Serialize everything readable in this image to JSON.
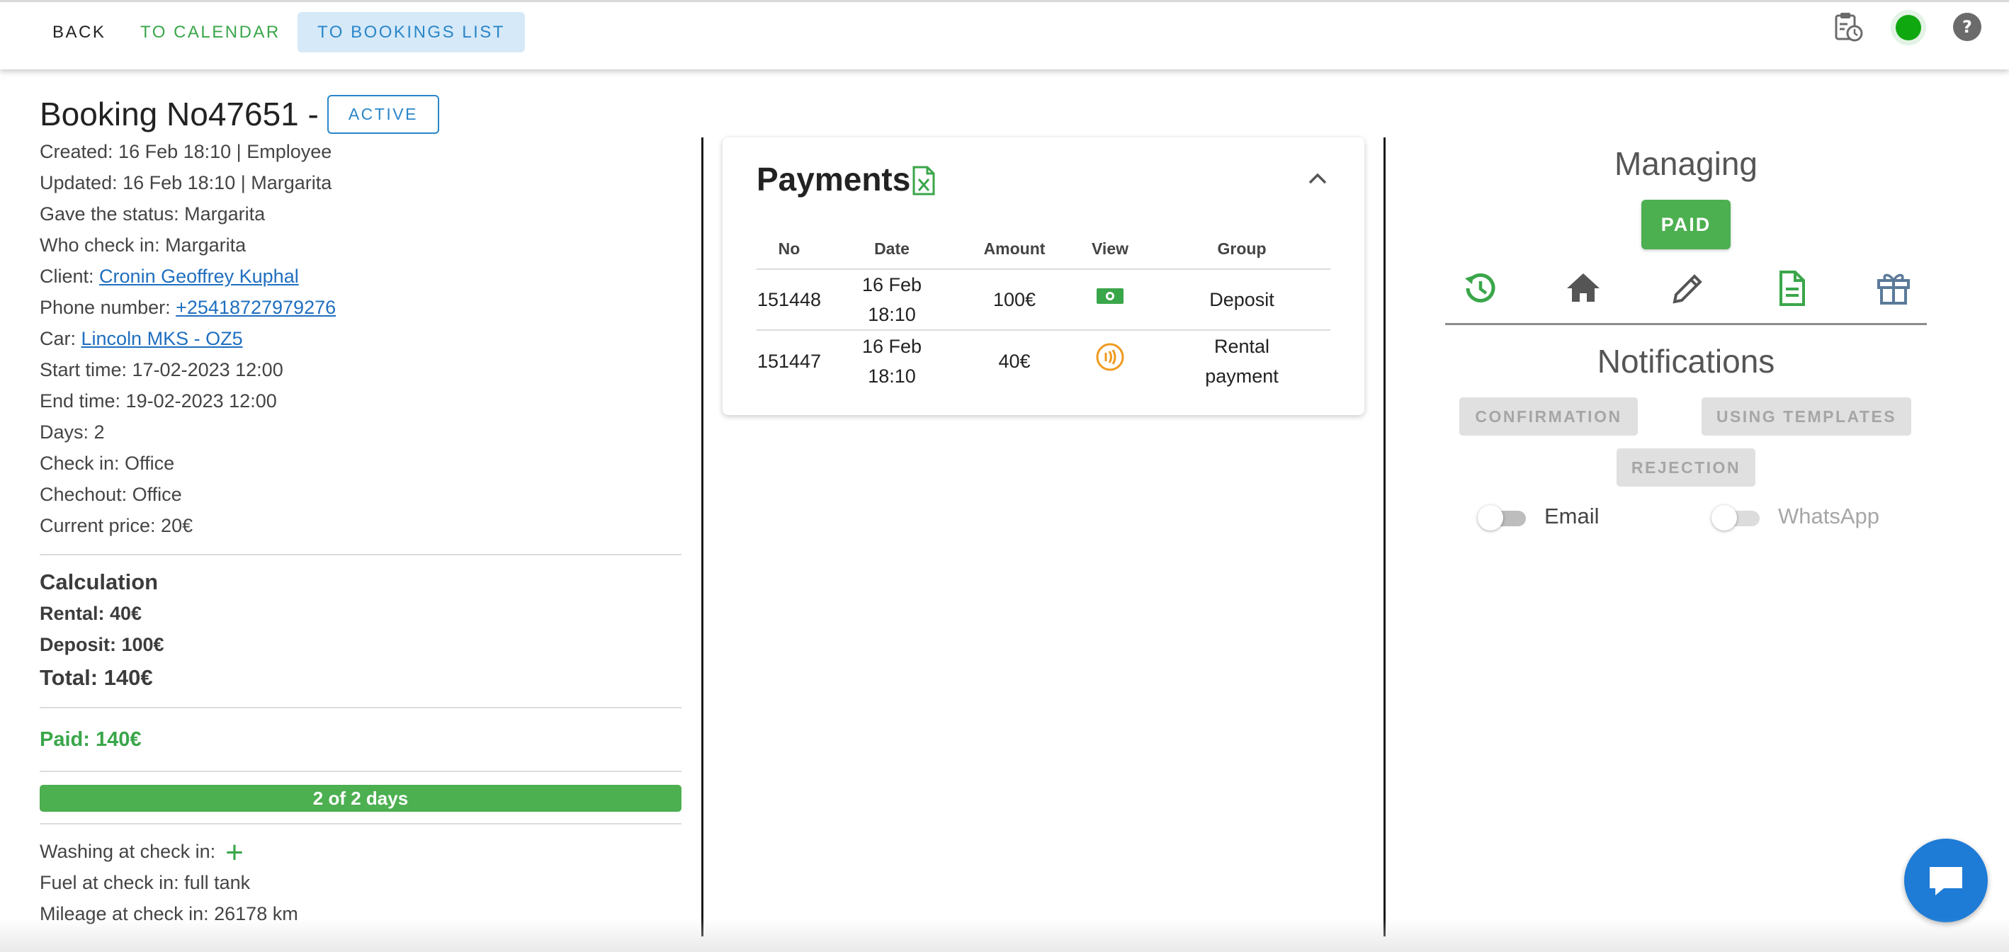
{
  "nav": {
    "back": "BACK",
    "calendar": "TO CALENDAR",
    "bookings_list": "TO BOOKINGS LIST"
  },
  "top_icons": [
    "clipboard-clock-icon",
    "online-status-dot",
    "help-icon"
  ],
  "colors": {
    "green": "#4caf50",
    "blue": "#2a86c9",
    "link": "#1f6fbf",
    "orange": "#f09a1e"
  },
  "booking": {
    "title": "Booking No47651 -",
    "status": "ACTIVE",
    "created": "Created: 16 Feb 18:10 | Employee",
    "updated": "Updated: 16 Feb 18:10 | Margarita",
    "gave_status": "Gave the status: Margarita",
    "who_check_in": "Who check in: Margarita",
    "client_label": "Client: ",
    "client_name": "Cronin Geoffrey Kuphal",
    "phone_label": "Phone number: ",
    "phone": "+25418727979276",
    "car_label": "Car: ",
    "car": "Lincoln MKS - OZ5",
    "start": "Start time: 17-02-2023 12:00",
    "end": "End time: 19-02-2023 12:00",
    "days": "Days: 2",
    "check_in": "Check in: Office",
    "checkout": "Chechout: Office",
    "current_price": "Current price: 20€"
  },
  "calculation": {
    "title": "Calculation",
    "rental": "Rental: 40€",
    "deposit": "Deposit: 100€",
    "total": "Total: 140€",
    "paid": "Paid: 140€",
    "progress_text": "2 of 2 days",
    "progress_fraction": 1.0
  },
  "extra": {
    "washing": "Washing at check in:",
    "fuel": "Fuel at check in: full tank",
    "mileage": "Mileage at check in: 26178 km"
  },
  "payments": {
    "title": "Payments",
    "headers": [
      "No",
      "Date",
      "Amount",
      "View",
      "Group"
    ],
    "rows": [
      {
        "no": "151448",
        "date_line1": "16 Feb",
        "date_line2": "18:10",
        "amount": "100€",
        "view_icon": "cash-icon",
        "group_line1": "Deposit",
        "group_line2": ""
      },
      {
        "no": "151447",
        "date_line1": "16 Feb",
        "date_line2": "18:10",
        "amount": "40€",
        "view_icon": "contactless-icon",
        "group_line1": "Rental",
        "group_line2": "payment"
      }
    ]
  },
  "managing": {
    "title": "Managing",
    "paid_button": "PAID",
    "action_icons": [
      "history-icon",
      "home-icon",
      "edit-icon",
      "document-icon",
      "gift-icon"
    ]
  },
  "notifications": {
    "title": "Notifications",
    "confirmation": "CONFIRMATION",
    "using_templates": "USING TEMPLATES",
    "rejection": "REJECTION",
    "email_label": "Email",
    "whatsapp_label": "WhatsApp"
  }
}
